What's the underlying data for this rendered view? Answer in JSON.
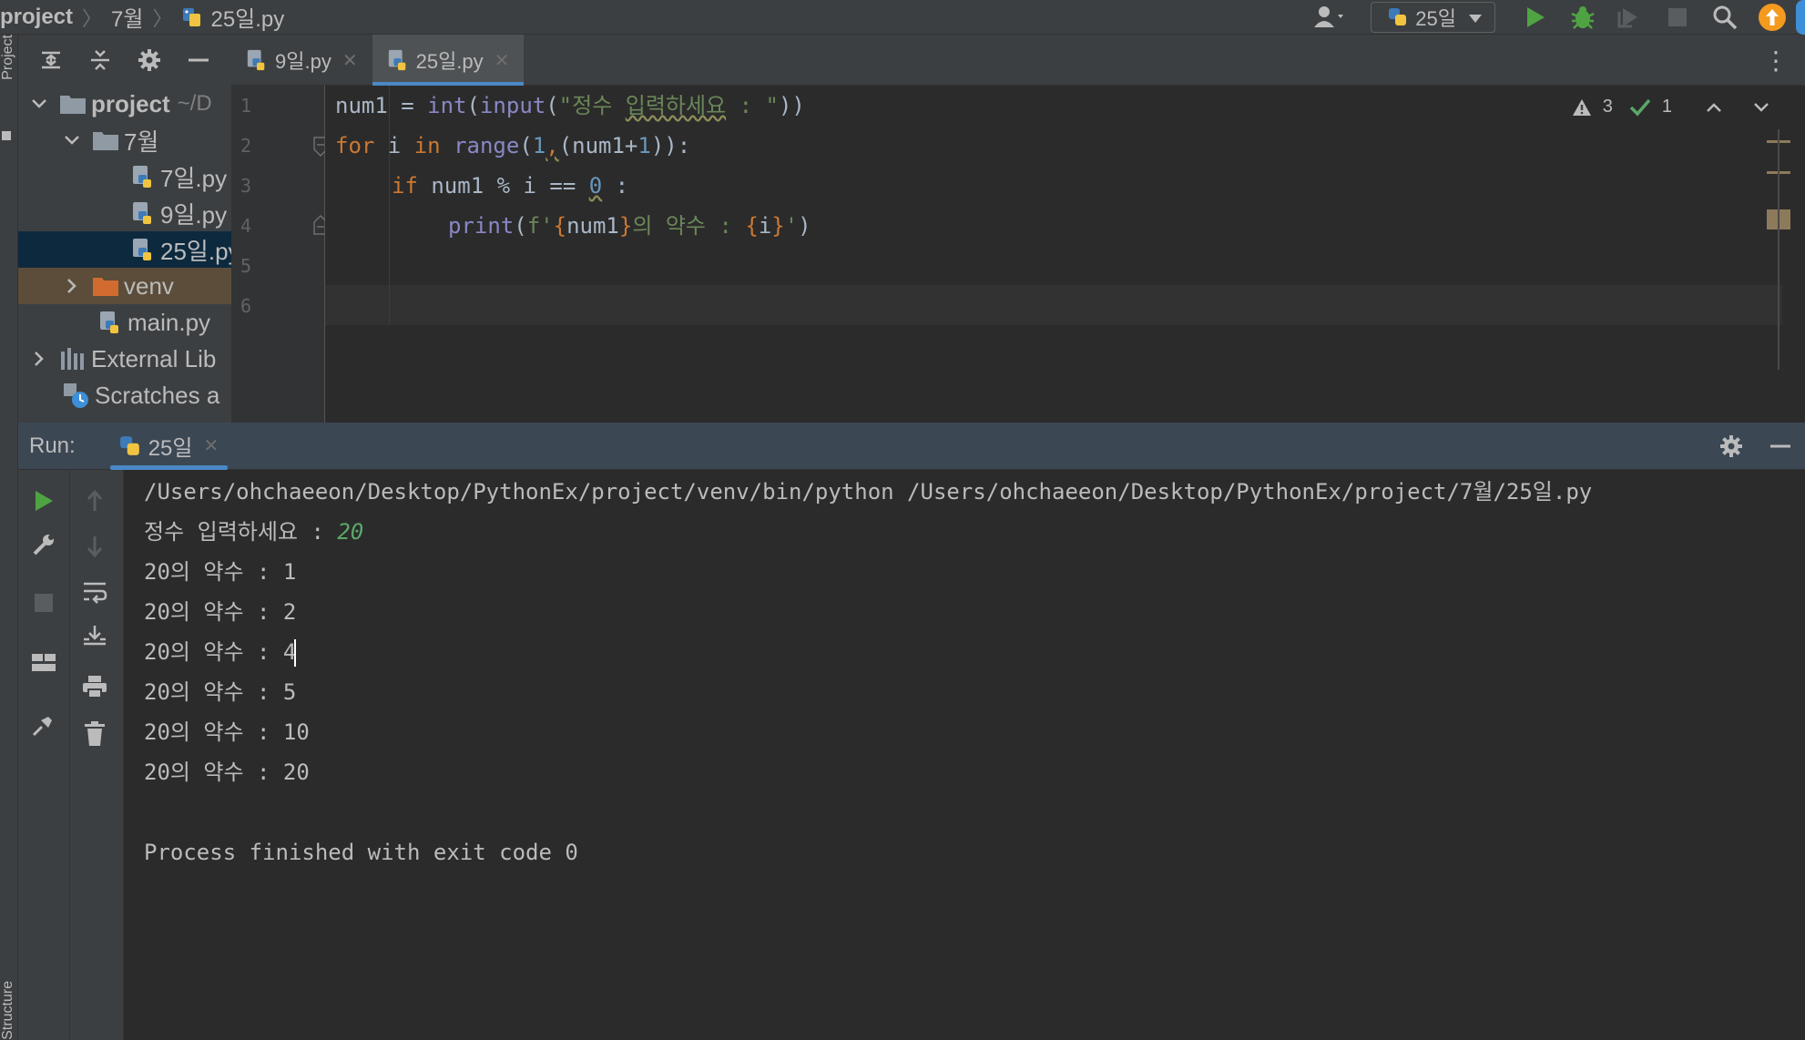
{
  "navbar": {
    "breadcrumbs": [
      "project",
      "7월",
      "25일.py"
    ],
    "run_config": "25일"
  },
  "left_strip": {
    "top_label": "Project",
    "bottom_label": "Structure"
  },
  "project_tree": {
    "items": [
      {
        "label": "project",
        "hint": "~/D"
      },
      {
        "label": "7월"
      },
      {
        "label": "7일.py"
      },
      {
        "label": "9일.py"
      },
      {
        "label": "25일.py"
      },
      {
        "label": "venv"
      },
      {
        "label": "main.py"
      },
      {
        "label": "External Lib"
      },
      {
        "label": "Scratches a"
      }
    ]
  },
  "editor": {
    "tabs": [
      {
        "label": "9일.py"
      },
      {
        "label": "25일.py"
      }
    ],
    "line_numbers": [
      "1",
      "2",
      "3",
      "4",
      "5",
      "6"
    ],
    "code": {
      "l1": {
        "a": "num1 = ",
        "b": "int",
        "c": "(",
        "d": "input",
        "e": "(",
        "f": "\"정수 ",
        "g": "입력하세요",
        "h": " : \"",
        "i": "))"
      },
      "l2": {
        "a": "for",
        "b": " i ",
        "c": "in",
        "d": " ",
        "e": "range",
        "f": "(",
        "g": "1",
        "h": ",",
        "i": "(num1+",
        "j": "1",
        "k": ")):"
      },
      "l3": {
        "a": "if",
        "b": " num1 % i == ",
        "c": "0",
        "d": " :"
      },
      "l4": {
        "a": "print",
        "b": "(",
        "c": "f'",
        "d": "{",
        "e": "num1",
        "f": "}",
        "g": "의 약수 : ",
        "h": "{",
        "i": "i",
        "j": "}",
        "k": "'",
        "l": ")"
      }
    },
    "warnings_count": "3",
    "ok_count": "1"
  },
  "run_panel": {
    "title": "Run:",
    "tab_label": "25일",
    "console": {
      "command": "/Users/ohchaeeon/Desktop/PythonEx/project/venv/bin/python /Users/ohchaeeon/Desktop/PythonEx/project/7월/25일.py",
      "prompt": "정수 입력하세요 : ",
      "user_input": "20",
      "outputs": [
        "20의 약수 : 1",
        "20의 약수 : 2",
        "20의 약수 : 4",
        "20의 약수 : 5",
        "20의 약수 : 10",
        "20의 약수 : 20"
      ],
      "exit_message": "Process finished with exit code 0"
    }
  },
  "colors": {
    "keyword": "#cc7832",
    "builtin": "#8888c6",
    "string": "#6a8759",
    "number": "#6897bb",
    "run_green": "#4fa343",
    "accent_blue": "#4a88c7",
    "selection": "#0d293e"
  }
}
